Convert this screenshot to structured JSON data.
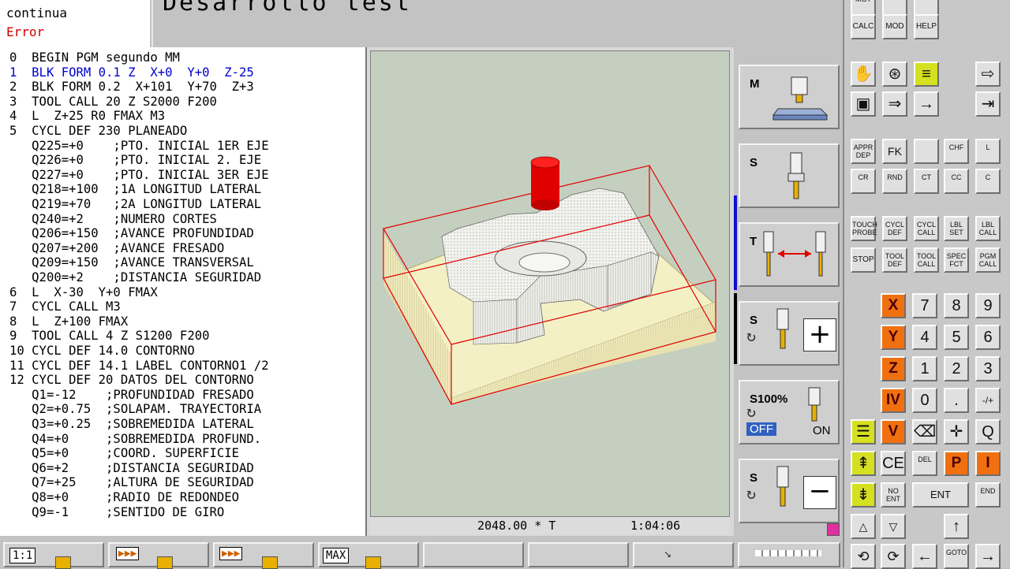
{
  "header": {
    "mode_line1": "continua",
    "mode_line2": "Error",
    "title": "Desarrollo test"
  },
  "program": {
    "lines": [
      "0  BEGIN PGM segundo MM",
      "1  BLK FORM 0.1 Z  X+0  Y+0  Z-25",
      "2  BLK FORM 0.2  X+101  Y+70  Z+3",
      "3  TOOL CALL 20 Z S2000 F200",
      "4  L  Z+25 R0 FMAX M3",
      "5  CYCL DEF 230 PLANEADO",
      "   Q225=+0    ;PTO. INICIAL 1ER EJE",
      "   Q226=+0    ;PTO. INICIAL 2. EJE",
      "   Q227=+0    ;PTO. INICIAL 3ER EJE",
      "   Q218=+100  ;1A LONGITUD LATERAL",
      "   Q219=+70   ;2A LONGITUD LATERAL",
      "   Q240=+2    ;NUMERO CORTES",
      "   Q206=+150  ;AVANCE PROFUNDIDAD",
      "   Q207=+200  ;AVANCE FRESADO",
      "   Q209=+150  ;AVANCE TRANSVERSAL",
      "   Q200=+2    ;DISTANCIA SEGURIDAD",
      "6  L  X-30  Y+0 FMAX",
      "7  CYCL CALL M3",
      "8  L  Z+100 FMAX",
      "9  TOOL CALL 4 Z S1200 F200",
      "10 CYCL DEF 14.0 CONTORNO",
      "11 CYCL DEF 14.1 LABEL CONTORNO1 /2",
      "12 CYCL DEF 20 DATOS DEL CONTORNO",
      "   Q1=-12    ;PROFUNDIDAD FRESADO",
      "   Q2=+0.75  ;SOLAPAM. TRAYECTORIA",
      "   Q3=+0.25  ;SOBREMEDIDA LATERAL",
      "   Q4=+0     ;SOBREMEDIDA PROFUND.",
      "   Q5=+0     ;COORD. SUPERFICIE",
      "   Q6=+2     ;DISTANCIA SEGURIDAD",
      "   Q7=+25    ;ALTURA DE SEGURIDAD",
      "   Q8=+0     ;RADIO DE REDONDEO",
      "   Q9=-1     ;SENTIDO DE GIRO"
    ],
    "highlighted_line": 1
  },
  "status": {
    "value": "2048.00 * T",
    "time": "1:04:06"
  },
  "softkeys_right": {
    "m_label": "M",
    "s_label": "S",
    "t_label": "T",
    "s_plus_label": "S",
    "override_label": "S100%",
    "off_label": "OFF",
    "on_label": "ON",
    "s_minus_label": "S"
  },
  "keyboard": {
    "row0": [
      "MGT",
      "",
      "CALC",
      "MOD",
      "HELP"
    ],
    "path_keys": [
      "APPR DEP",
      "FK",
      "CHF",
      "L",
      "CR",
      "RND",
      "CT",
      "CC",
      "C"
    ],
    "cycle_keys": [
      "TOUCH PROBE",
      "CYCL DEF",
      "CYCL CALL",
      "LBL SET",
      "LBL CALL",
      "STOP",
      "TOOL DEF",
      "TOOL CALL",
      "SPEC FCT",
      "PGM CALL"
    ],
    "axis_keys": [
      "X",
      "Y",
      "Z",
      "IV",
      "V"
    ],
    "digits": [
      "7",
      "8",
      "9",
      "4",
      "5",
      "6",
      "1",
      "2",
      "3",
      "0",
      ".",
      "-/+"
    ],
    "special": [
      "P",
      "I",
      "Q",
      "CE",
      "DEL",
      "NO ENT",
      "ENT",
      "END",
      "GOTO"
    ]
  },
  "bottom_softkeys": {
    "scale_label": "1:1",
    "max_label": "MAX"
  }
}
